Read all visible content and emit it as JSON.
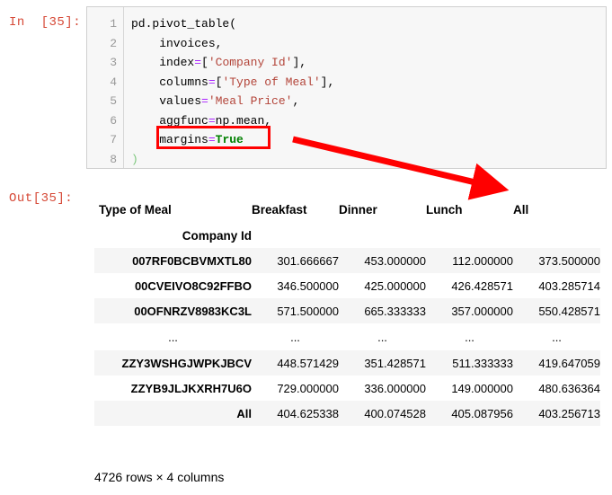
{
  "notebook": {
    "in_prompt": "In  [35]:",
    "out_prompt": "Out[35]:"
  },
  "code_cell": {
    "line_numbers": [
      "1",
      "2",
      "3",
      "4",
      "5",
      "6",
      "7",
      "8"
    ],
    "lines": [
      "pd.pivot_table(",
      "    invoices,",
      "    index=['Company Id'],",
      "    columns=['Type of Meal'],",
      "    values='Meal Price',",
      "    aggfunc=np.mean,",
      "    margins=True",
      ")"
    ],
    "tokens": {
      "l1_plain": "pd.pivot_table(",
      "l2_plain": "    invoices,",
      "l3_name": "    index",
      "l3_eq": "=",
      "l3_br1": "[",
      "l3_str": "'Company Id'",
      "l3_br2": "],",
      "l4_name": "    columns",
      "l4_eq": "=",
      "l4_br1": "[",
      "l4_str": "'Type of Meal'",
      "l4_br2": "],",
      "l5_name": "    values",
      "l5_eq": "=",
      "l5_str": "'Meal Price'",
      "l5_comma": ",",
      "l6_plain": "    aggfunc",
      "l6_eq": "=",
      "l6_rest": "np.mean,",
      "l7_name": "    margins",
      "l7_eq": "=",
      "l7_kw": "True",
      "l8_paren": ")"
    },
    "highlight": {
      "target": "margins=True",
      "border_color": "#ff0000"
    }
  },
  "annotation": {
    "arrow_color": "#ff0000",
    "arrow_from": "margins=True",
    "arrow_to": "All column header"
  },
  "output_table": {
    "column_axis_name": "Type of Meal",
    "index_axis_name": "Company Id",
    "columns": [
      "Breakfast",
      "Dinner",
      "Lunch",
      "All"
    ],
    "rows": [
      {
        "index": "007RF0BCBVMXTL80",
        "values": [
          "301.666667",
          "453.000000",
          "112.000000",
          "373.500000"
        ]
      },
      {
        "index": "00CVEIVO8C92FFBO",
        "values": [
          "346.500000",
          "425.000000",
          "426.428571",
          "403.285714"
        ]
      },
      {
        "index": "00OFNRZV8983KC3L",
        "values": [
          "571.500000",
          "665.333333",
          "357.000000",
          "550.428571"
        ]
      },
      {
        "index": "...",
        "values": [
          "...",
          "...",
          "...",
          "..."
        ],
        "is_ellipsis": true
      },
      {
        "index": "ZZY3WSHGJWPKJBCV",
        "values": [
          "448.571429",
          "351.428571",
          "511.333333",
          "419.647059"
        ]
      },
      {
        "index": "ZZYB9JLJKXRH7U6O",
        "values": [
          "729.000000",
          "336.000000",
          "149.000000",
          "480.636364"
        ]
      },
      {
        "index": "All",
        "values": [
          "404.625338",
          "400.074528",
          "405.087956",
          "403.256713"
        ]
      }
    ],
    "shape_text": "4726 rows × 4 columns"
  }
}
